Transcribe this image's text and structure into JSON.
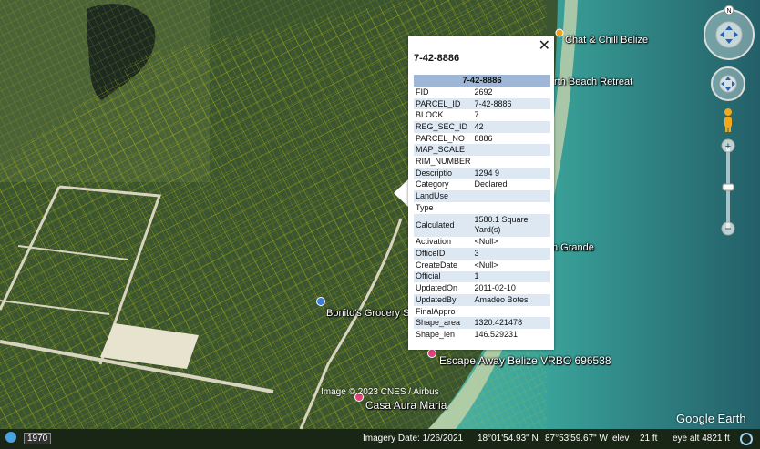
{
  "map": {
    "places": [
      {
        "id": "chat-chill",
        "label": "Chat & Chill Belize"
      },
      {
        "id": "beach-retreat",
        "label": "rth Beach Retreat"
      },
      {
        "id": "grande",
        "label": "n Grande"
      },
      {
        "id": "bonito",
        "label": "Bonito's Grocery S"
      },
      {
        "id": "escape-away",
        "label": "Escape Away Belize VRBO 696538"
      },
      {
        "id": "casa-aura",
        "label": "Casa Aura Maria"
      }
    ]
  },
  "popup": {
    "title": "7-42-8886",
    "table_header": "7-42-8886",
    "close_glyph": "✕",
    "rows": [
      {
        "key": "FID",
        "value": "2692"
      },
      {
        "key": "PARCEL_ID",
        "value": "7-42-8886"
      },
      {
        "key": "BLOCK",
        "value": "7"
      },
      {
        "key": "REG_SEC_ID",
        "value": "42"
      },
      {
        "key": "PARCEL_NO",
        "value": "8886"
      },
      {
        "key": "MAP_SCALE",
        "value": ""
      },
      {
        "key": "RIM_NUMBER",
        "value": ""
      },
      {
        "key": "Descriptio",
        "value": "1294 9"
      },
      {
        "key": "Category",
        "value": "Declared"
      },
      {
        "key": "LandUse",
        "value": ""
      },
      {
        "key": "Type",
        "value": ""
      },
      {
        "key": "Calculated",
        "value": "1580.1 Square Yard(s)"
      },
      {
        "key": "Activation",
        "value": "<Null>"
      },
      {
        "key": "OfficeID",
        "value": "3"
      },
      {
        "key": "CreateDate",
        "value": "<Null>"
      },
      {
        "key": "Official",
        "value": "1"
      },
      {
        "key": "UpdatedOn",
        "value": "2011-02-10"
      },
      {
        "key": "UpdatedBy",
        "value": "Amadeo Botes"
      },
      {
        "key": "FinalAppro",
        "value": ""
      },
      {
        "key": "Shape_area",
        "value": "1320.421478"
      },
      {
        "key": "Shape_len",
        "value": "146.529231"
      }
    ]
  },
  "nav": {
    "north_label": "N"
  },
  "overlay": {
    "copyright": "Image © 2023 CNES / Airbus",
    "logo": "Google Earth",
    "year": "1970"
  },
  "status": {
    "imagery_date": "Imagery Date: 1/26/2021",
    "lat": "18°01'54.93\" N",
    "lon": "87°53'59.67\" W",
    "elev_label": "elev",
    "elev_value": "21 ft",
    "eye_alt": "eye alt   4821 ft"
  },
  "colors": {
    "parcel_lines": "#e6e600",
    "land": "#3f5a30",
    "sea_shallow": "#3aa39a",
    "sea_deep": "#1f6f7a",
    "table_header": "#9fb7d6"
  }
}
